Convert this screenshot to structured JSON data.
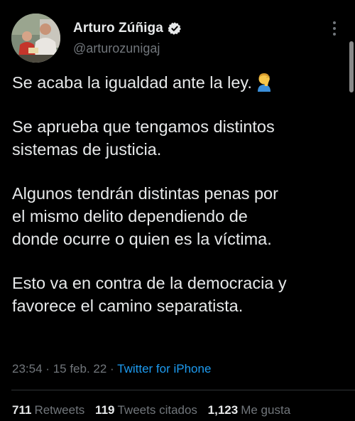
{
  "tweet": {
    "author": {
      "display_name": "Arturo Zúñiga",
      "handle": "@arturozunigaj",
      "verified_icon": "verified-badge-icon"
    },
    "paragraphs": [
      "Se acaba la igualdad ante la ley.",
      "Se aprueba que tengamos distintos\nsistemas de justicia.",
      "Algunos tendrán distintas penas por\nel mismo delito dependiendo de\ndonde ocurre o quien es la víctima.",
      "Esto va en contra de la democracia y\nfavorece el camino separatista."
    ],
    "emoji": "man-facepalming-emoji",
    "time": "23:54",
    "separator": "·",
    "date": "15 feb. 22",
    "source": "Twitter for iPhone",
    "stats": {
      "retweets_count": "711",
      "retweets_label": "Retweets",
      "quotes_count": "119",
      "quotes_label": "Tweets citados",
      "likes_count": "1,123",
      "likes_label": "Me gusta"
    }
  },
  "colors": {
    "background": "#000000",
    "text": "#e7e9ea",
    "secondary": "#71767b",
    "link": "#1d9bf0",
    "verified": "#e7e9ea"
  }
}
